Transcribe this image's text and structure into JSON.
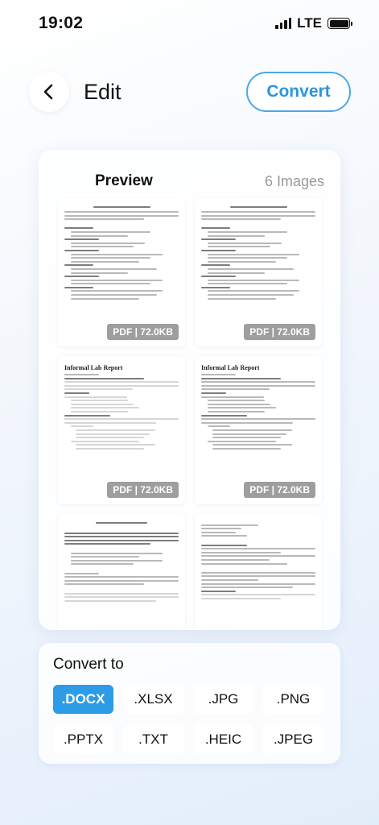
{
  "status_bar": {
    "time": "19:02",
    "network": "LTE"
  },
  "header": {
    "title": "Edit",
    "convert_label": "Convert"
  },
  "preview": {
    "title": "Preview",
    "count": "6 Images",
    "items": [
      {
        "badge": "PDF | 72.0KB"
      },
      {
        "badge": "PDF | 72.0KB"
      },
      {
        "badge": "PDF | 72.0KB",
        "doc_title": "Informal Lab Report"
      },
      {
        "badge": "PDF | 72.0KB",
        "doc_title": "Informal Lab Report"
      },
      {
        "badge": ""
      },
      {
        "badge": ""
      }
    ]
  },
  "convert_to": {
    "title": "Convert to",
    "formats": [
      ".DOCX",
      ".XLSX",
      ".JPG",
      ".PNG",
      ".PPTX",
      ".TXT",
      ".HEIC",
      ".JPEG"
    ],
    "selected": ".DOCX"
  },
  "colors": {
    "accent": "#2d9be6",
    "convert_border": "#4aa8e8"
  },
  "icons": {
    "back": "chevron-left-icon",
    "signal": "cellular-signal-icon",
    "battery": "battery-icon"
  }
}
